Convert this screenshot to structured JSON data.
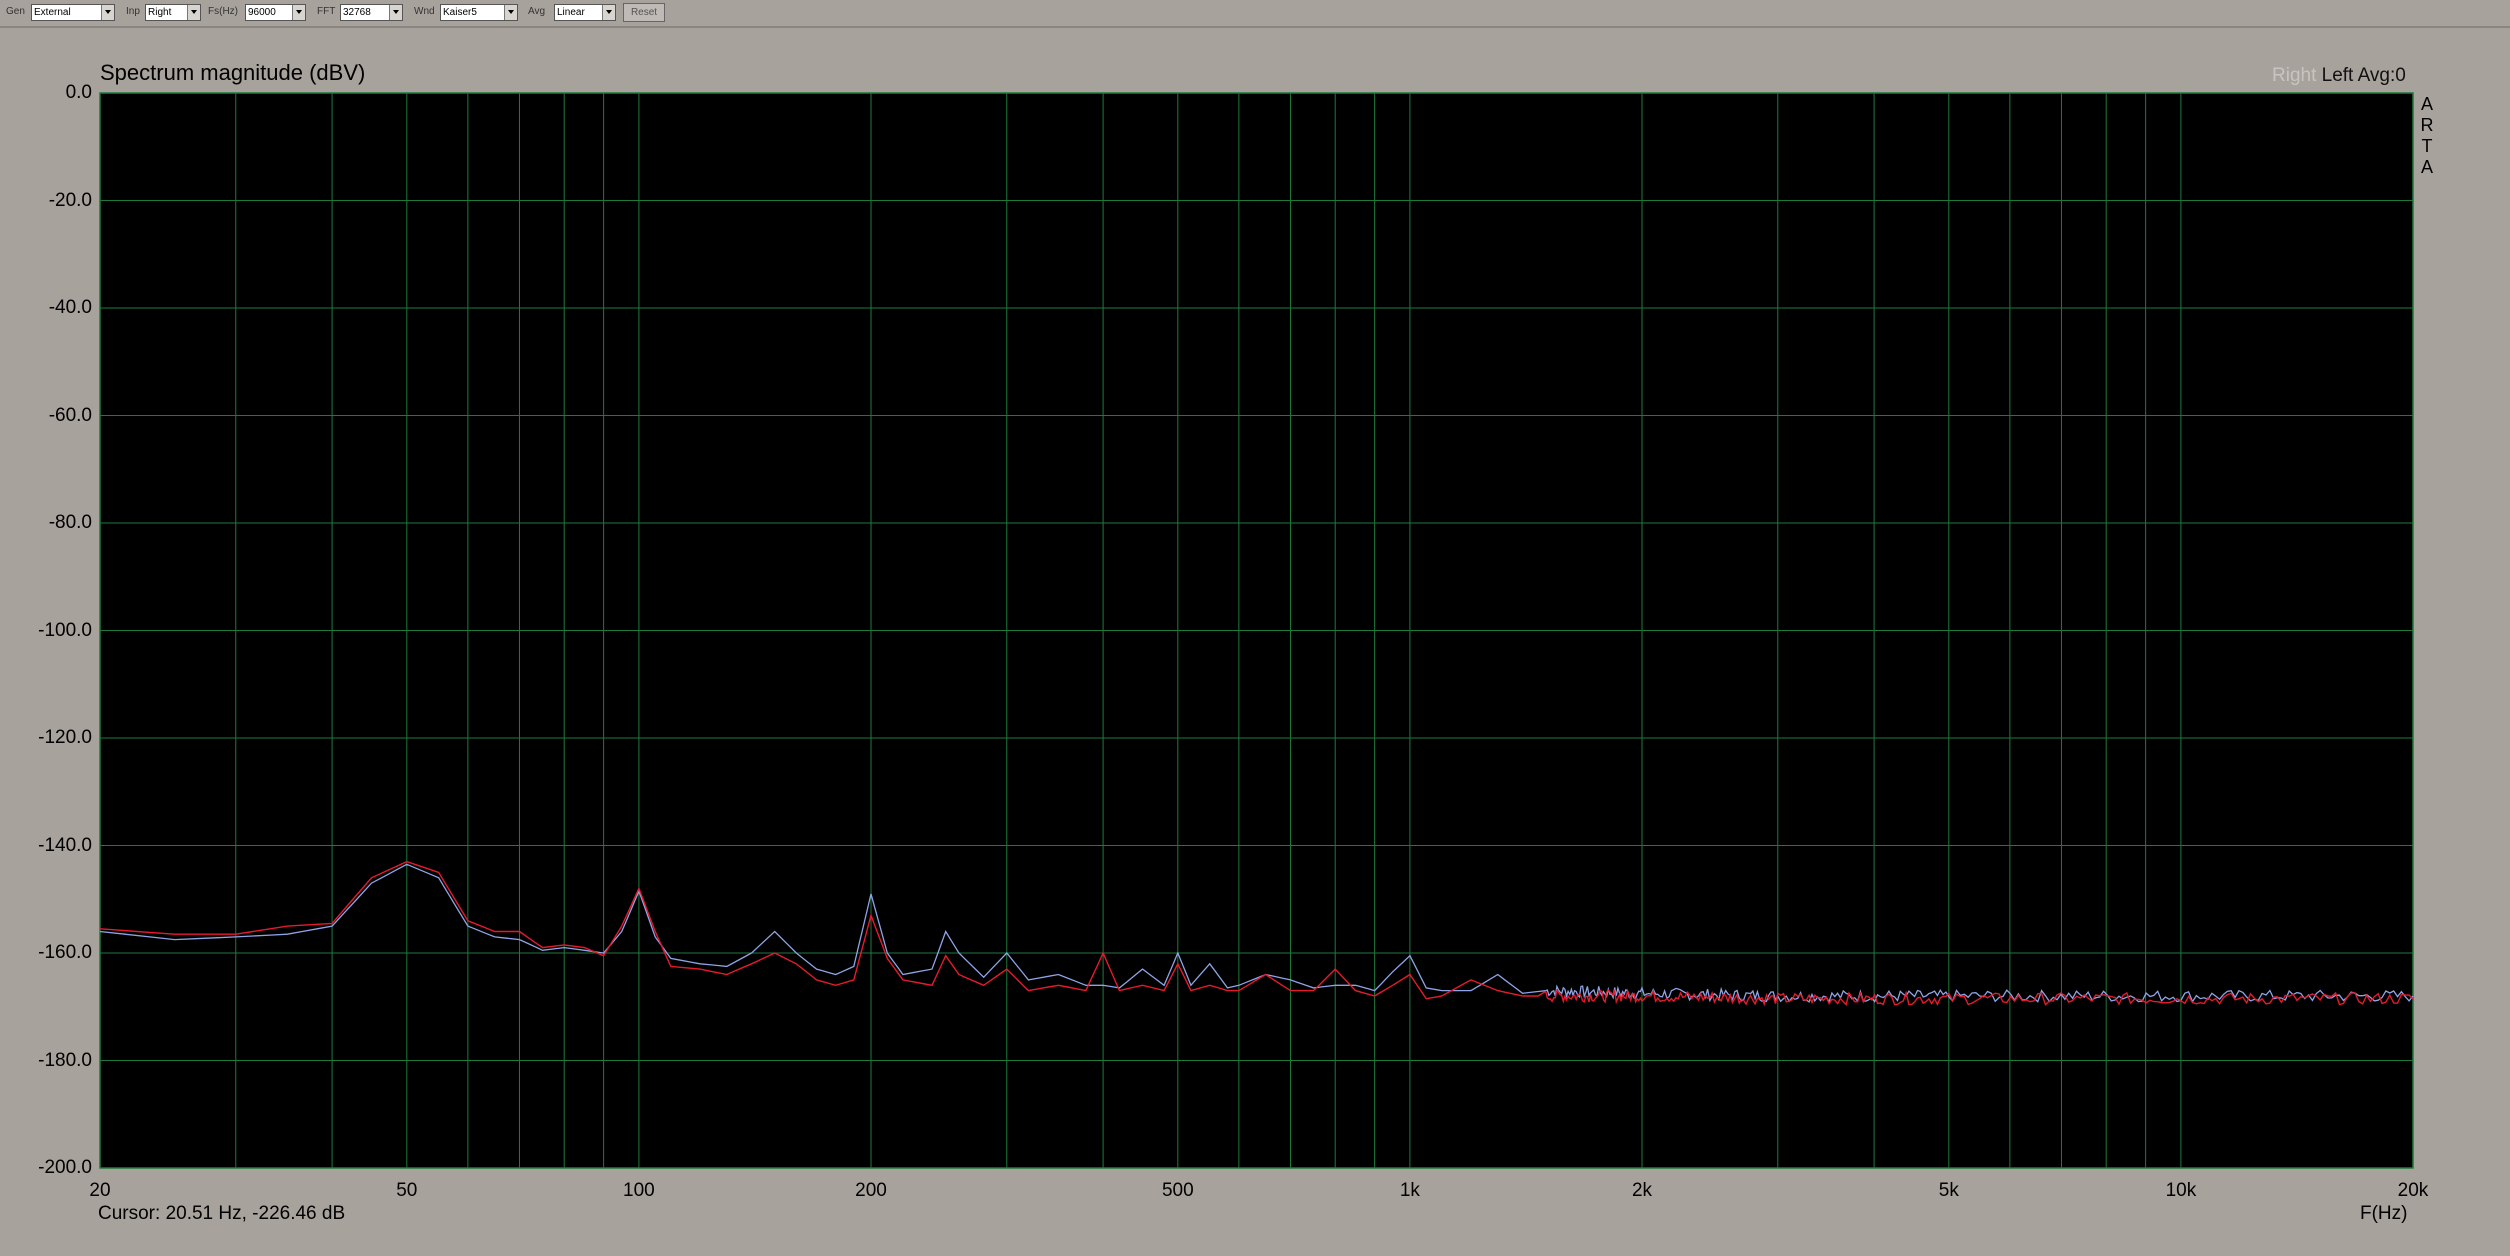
{
  "toolbar": {
    "gen": {
      "label": "Gen",
      "value": "External"
    },
    "inp": {
      "label": "Inp",
      "value": "Right"
    },
    "fs": {
      "label": "Fs(Hz)",
      "value": "96000"
    },
    "fft": {
      "label": "FFT",
      "value": "32768"
    },
    "wnd": {
      "label": "Wnd",
      "value": "Kaiser5"
    },
    "avg": {
      "label": "Avg",
      "value": "Linear"
    },
    "reset_label": "Reset"
  },
  "plot": {
    "title": "Spectrum magnitude (dBV)",
    "channel_right": "Right",
    "channel_left": "Left",
    "avg_label": "Avg:",
    "avg_value": "0",
    "arta": [
      "A",
      "R",
      "T",
      "A"
    ],
    "xlabel": "F(Hz)",
    "cursor_text": "Cursor: 20.51 Hz, -226.46 dB"
  },
  "colors": {
    "plot_bg": "#000000",
    "grid": "#1e7a3c",
    "series_blue": "#8ea4e6",
    "series_red": "#e61a2e"
  },
  "chart_data": {
    "type": "line",
    "title": "Spectrum magnitude (dBV)",
    "xlabel": "F(Hz)",
    "ylabel": "",
    "xscale": "log",
    "xlim": [
      20,
      20000
    ],
    "ylim": [
      -200,
      0
    ],
    "grid": true,
    "yticks": [
      "0.0",
      "-20.0",
      "-40.0",
      "-60.0",
      "-80.0",
      "-100.0",
      "-120.0",
      "-140.0",
      "-160.0",
      "-180.0",
      "-200.0"
    ],
    "yvalues": [
      0,
      -20,
      -40,
      -60,
      -80,
      -100,
      -120,
      -140,
      -160,
      -180,
      -200
    ],
    "xticks": [
      "20",
      "50",
      "100",
      "200",
      "500",
      "1k",
      "2k",
      "5k",
      "10k",
      "20k"
    ],
    "xvalues": [
      20,
      50,
      100,
      200,
      500,
      1000,
      2000,
      5000,
      10000,
      20000
    ],
    "series": [
      {
        "color": "#8ea4e6",
        "points": [
          [
            20,
            -156
          ],
          [
            25,
            -157.5
          ],
          [
            30,
            -157
          ],
          [
            35,
            -156.5
          ],
          [
            40,
            -155
          ],
          [
            45,
            -147
          ],
          [
            50,
            -143.5
          ],
          [
            55,
            -146
          ],
          [
            60,
            -155
          ],
          [
            65,
            -157
          ],
          [
            70,
            -157.5
          ],
          [
            75,
            -159.5
          ],
          [
            80,
            -159
          ],
          [
            85,
            -159.5
          ],
          [
            90,
            -160
          ],
          [
            95,
            -156
          ],
          [
            100,
            -148.5
          ],
          [
            105,
            -157
          ],
          [
            110,
            -161
          ],
          [
            120,
            -162
          ],
          [
            130,
            -162.5
          ],
          [
            140,
            -160
          ],
          [
            150,
            -156
          ],
          [
            160,
            -160
          ],
          [
            170,
            -163
          ],
          [
            180,
            -164
          ],
          [
            190,
            -162.5
          ],
          [
            200,
            -149
          ],
          [
            210,
            -160
          ],
          [
            220,
            -164
          ],
          [
            240,
            -163
          ],
          [
            250,
            -156
          ],
          [
            260,
            -160
          ],
          [
            280,
            -164.5
          ],
          [
            300,
            -160
          ],
          [
            320,
            -165
          ],
          [
            350,
            -164
          ],
          [
            380,
            -166
          ],
          [
            400,
            -166
          ],
          [
            420,
            -166.5
          ],
          [
            450,
            -163
          ],
          [
            480,
            -166
          ],
          [
            500,
            -160
          ],
          [
            520,
            -166
          ],
          [
            550,
            -162
          ],
          [
            580,
            -166.5
          ],
          [
            600,
            -166
          ],
          [
            650,
            -164
          ],
          [
            700,
            -165
          ],
          [
            750,
            -166.5
          ],
          [
            800,
            -166
          ],
          [
            850,
            -166
          ],
          [
            900,
            -167
          ],
          [
            950,
            -163.5
          ],
          [
            1000,
            -160.5
          ],
          [
            1050,
            -166.5
          ],
          [
            1100,
            -167
          ],
          [
            1200,
            -167
          ],
          [
            1300,
            -164
          ],
          [
            1400,
            -167.5
          ],
          [
            1500,
            -167
          ],
          [
            2000,
            -167.5
          ],
          [
            3000,
            -168
          ],
          [
            5000,
            -168
          ],
          [
            10000,
            -168
          ],
          [
            20000,
            -168
          ]
        ]
      },
      {
        "color": "#e61a2e",
        "points": [
          [
            20,
            -155.5
          ],
          [
            25,
            -156.5
          ],
          [
            30,
            -156.5
          ],
          [
            35,
            -155
          ],
          [
            40,
            -154.5
          ],
          [
            45,
            -146
          ],
          [
            50,
            -143
          ],
          [
            55,
            -145
          ],
          [
            60,
            -154
          ],
          [
            65,
            -156
          ],
          [
            70,
            -156
          ],
          [
            75,
            -159
          ],
          [
            80,
            -158.5
          ],
          [
            85,
            -159
          ],
          [
            90,
            -160.5
          ],
          [
            95,
            -155
          ],
          [
            100,
            -148
          ],
          [
            105,
            -156
          ],
          [
            110,
            -162.5
          ],
          [
            120,
            -163
          ],
          [
            130,
            -164
          ],
          [
            140,
            -162
          ],
          [
            150,
            -160
          ],
          [
            160,
            -162
          ],
          [
            170,
            -165
          ],
          [
            180,
            -166
          ],
          [
            190,
            -165
          ],
          [
            200,
            -153
          ],
          [
            210,
            -161
          ],
          [
            220,
            -165
          ],
          [
            240,
            -166
          ],
          [
            250,
            -160.5
          ],
          [
            260,
            -164
          ],
          [
            280,
            -166
          ],
          [
            300,
            -163
          ],
          [
            320,
            -167
          ],
          [
            350,
            -166
          ],
          [
            380,
            -167
          ],
          [
            400,
            -160
          ],
          [
            420,
            -167
          ],
          [
            450,
            -166
          ],
          [
            480,
            -167
          ],
          [
            500,
            -162
          ],
          [
            520,
            -167
          ],
          [
            550,
            -166
          ],
          [
            580,
            -167
          ],
          [
            600,
            -167
          ],
          [
            650,
            -164
          ],
          [
            700,
            -167
          ],
          [
            750,
            -167
          ],
          [
            800,
            -163
          ],
          [
            850,
            -167
          ],
          [
            900,
            -168
          ],
          [
            950,
            -166
          ],
          [
            1000,
            -164
          ],
          [
            1050,
            -168.5
          ],
          [
            1100,
            -168
          ],
          [
            1200,
            -165
          ],
          [
            1300,
            -167
          ],
          [
            1400,
            -168
          ],
          [
            1500,
            -168
          ],
          [
            2000,
            -168
          ],
          [
            3000,
            -168.5
          ],
          [
            5000,
            -168.5
          ],
          [
            10000,
            -168.5
          ],
          [
            20000,
            -168.5
          ]
        ]
      }
    ]
  }
}
